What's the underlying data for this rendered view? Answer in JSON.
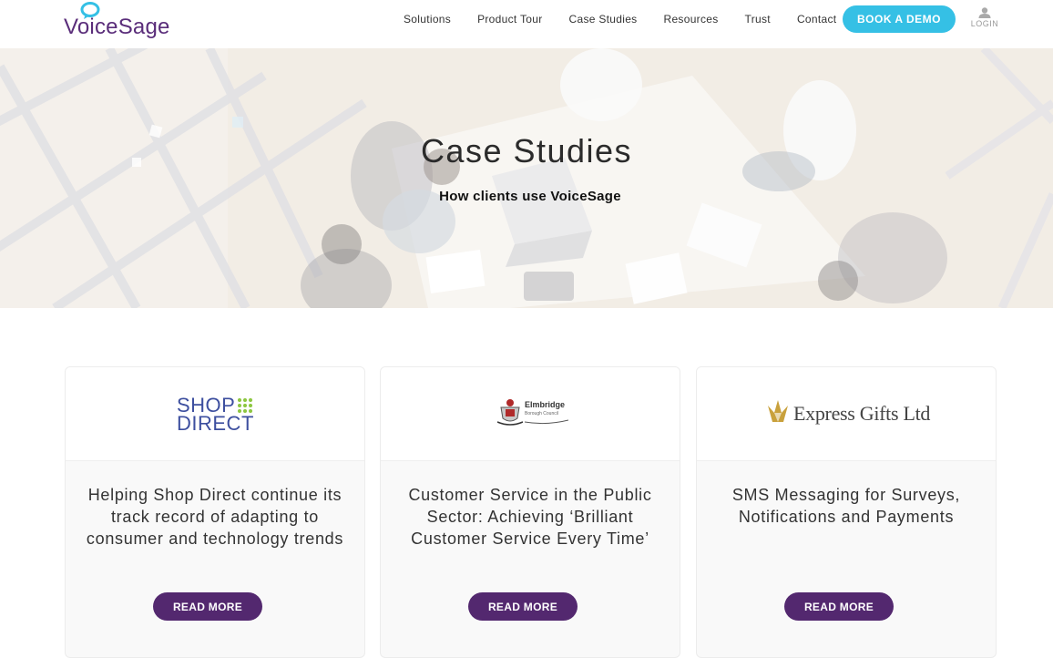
{
  "header": {
    "logo_text": "VoiceSage",
    "nav": [
      "Solutions",
      "Product Tour",
      "Case Studies",
      "Resources",
      "Trust",
      "Contact"
    ],
    "demo_label": "BOOK A DEMO",
    "login_label": "LOGIN"
  },
  "hero": {
    "title": "Case Studies",
    "subtitle": "How clients use VoiceSage"
  },
  "cards": [
    {
      "logo": {
        "line1": "SHOP",
        "line2": "DIRECT"
      },
      "title": "Helping Shop Direct continue its track record of adapting to consumer and technology trends",
      "button": "READ MORE"
    },
    {
      "logo": {
        "name": "Elmbridge",
        "sub": "Borough Council"
      },
      "title": "Customer Service in the Public Sector: Achieving ‘Brilliant Customer Service Every Time’",
      "button": "READ MORE"
    },
    {
      "logo": {
        "name": "Express Gifts Ltd"
      },
      "title": "SMS Messaging for Surveys, Notifications and Payments",
      "button": "READ MORE"
    }
  ],
  "colors": {
    "brand_purple": "#53286f",
    "logo_purple": "#5a2d7a",
    "accent_cyan": "#35c0e5",
    "shop_direct_blue": "#3d4f9f",
    "shop_direct_green": "#8cc63f",
    "express_gold": "#c9a13c"
  },
  "icons": {
    "logo": "speech-bubble-icon",
    "login": "user-icon"
  }
}
